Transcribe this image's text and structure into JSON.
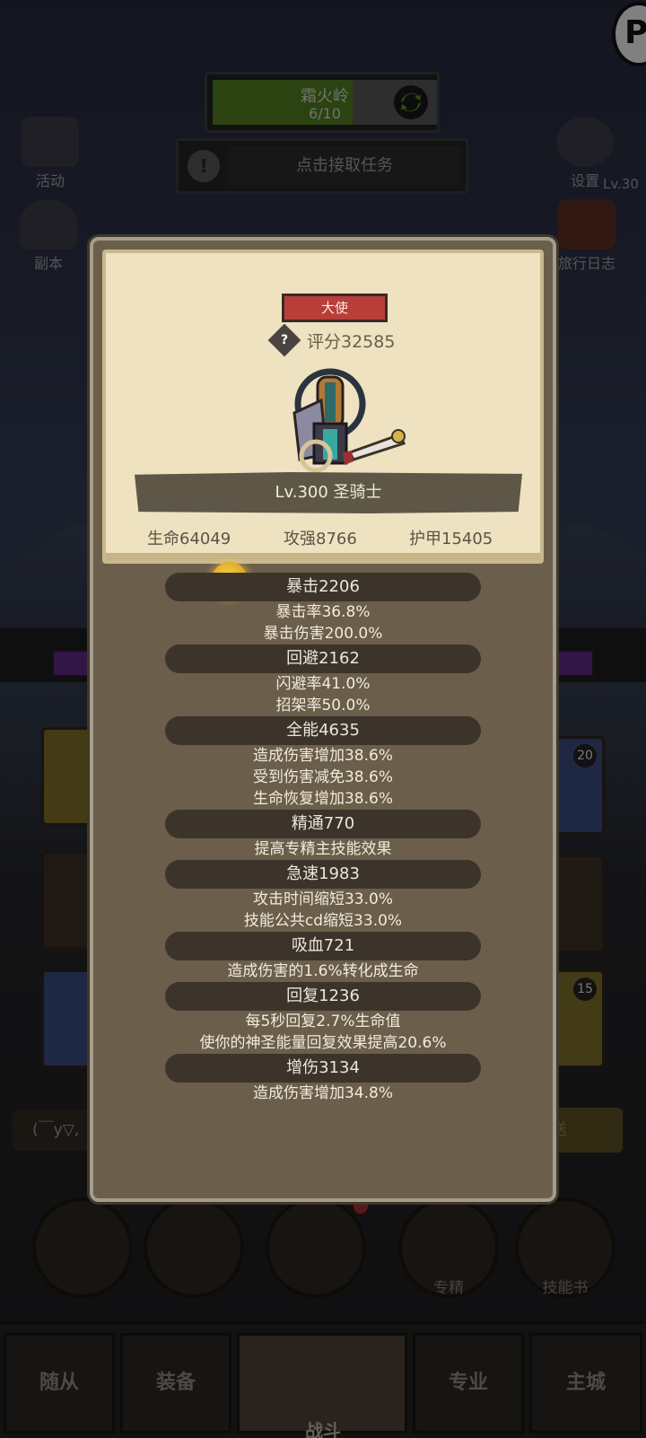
{
  "background": {
    "quest": {
      "title": "霜火岭",
      "progress": "6/10"
    },
    "task_prompt": "点击接取任务",
    "left_icons": [
      {
        "label": "活动"
      },
      {
        "label": "副本"
      }
    ],
    "right_icons": [
      {
        "label": "设置"
      },
      {
        "label": "旅行日志"
      }
    ],
    "side_level": "Lv.30",
    "chat_placeholder": "(￣y▽,",
    "send_label": "送",
    "slot_badges": [
      "20",
      "15"
    ],
    "action_labels": [
      "专精",
      "技能书"
    ],
    "nav_tabs": [
      "随从",
      "装备",
      "战斗",
      "专业",
      "主城"
    ]
  },
  "character": {
    "rank_badge": "大使",
    "score": "评分32585",
    "name": "Lv.300 圣骑士",
    "main_stats": [
      "生命64049",
      "攻强8766",
      "护甲15405"
    ]
  },
  "stat_groups": [
    {
      "header": "暴击2206",
      "lines": [
        "暴击率36.8%",
        "暴击伤害200.0%"
      ]
    },
    {
      "header": "回避2162",
      "lines": [
        "闪避率41.0%",
        "招架率50.0%"
      ]
    },
    {
      "header": "全能4635",
      "lines": [
        "造成伤害增加38.6%",
        "受到伤害减免38.6%",
        "生命恢复增加38.6%"
      ]
    },
    {
      "header": "精通770",
      "lines": [
        "提高专精主技能效果"
      ]
    },
    {
      "header": "急速1983",
      "lines": [
        "攻击时间缩短33.0%",
        "技能公共cd缩短33.0%"
      ]
    },
    {
      "header": "吸血721",
      "lines": [
        "造成伤害的1.6%转化成生命"
      ]
    },
    {
      "header": "回复1236",
      "lines": [
        "每5秒回复2.7%生命值",
        "使你的神圣能量回复效果提高20.6%"
      ]
    },
    {
      "header": "增伤3134",
      "lines": [
        "造成伤害增加34.8%"
      ]
    }
  ],
  "colors": {
    "panel": "#6b5e4a",
    "parchment": "#eee2c0",
    "rank_red": "#b83e3a",
    "header_dark": "#3c342b"
  }
}
